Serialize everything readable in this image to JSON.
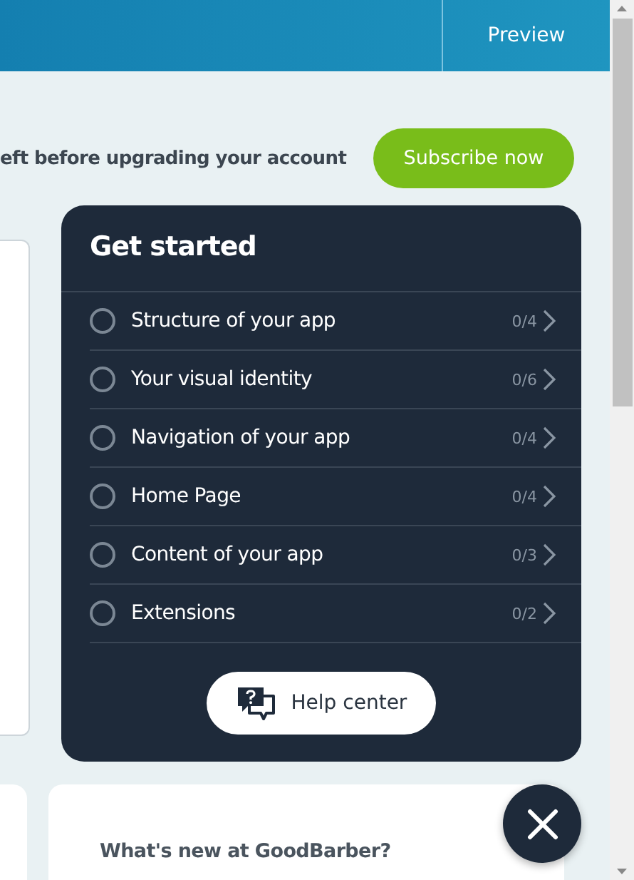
{
  "header": {
    "preview_button": "Preview"
  },
  "banner": {
    "text": "eft before upgrading your account",
    "button": "Subscribe now"
  },
  "get_started": {
    "title": "Get started",
    "steps": [
      {
        "label": "Structure of your app",
        "progress": "0/4",
        "checked": false
      },
      {
        "label": "Your visual identity",
        "progress": "0/6",
        "checked": false
      },
      {
        "label": "Navigation of your app",
        "progress": "0/4",
        "checked": false
      },
      {
        "label": "Home Page",
        "progress": "0/4",
        "checked": false
      },
      {
        "label": "Content of your app",
        "progress": "0/3",
        "checked": false
      },
      {
        "label": "Extensions",
        "progress": "0/2",
        "checked": false
      }
    ],
    "help_button": "Help center"
  },
  "news_card": {
    "title": "What's new at GoodBarber?"
  }
}
